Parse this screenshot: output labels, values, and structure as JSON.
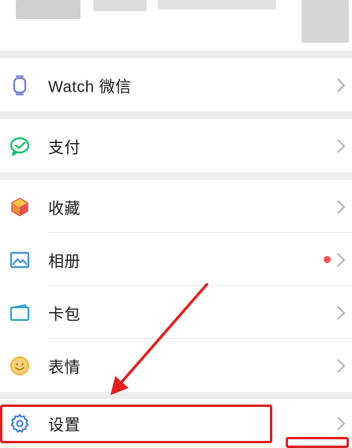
{
  "menu": {
    "watch": {
      "label": "Watch 微信",
      "icon": "watch-icon"
    },
    "pay": {
      "label": "支付",
      "icon": "wallet-icon"
    },
    "favorites": {
      "label": "收藏",
      "icon": "cube-icon"
    },
    "album": {
      "label": "相册",
      "icon": "image-icon",
      "has_badge": true
    },
    "card": {
      "label": "卡包",
      "icon": "card-icon"
    },
    "emoji": {
      "label": "表情",
      "icon": "smile-icon"
    },
    "settings": {
      "label": "设置",
      "icon": "gear-icon"
    }
  },
  "colors": {
    "background": "#ededed",
    "row": "#ffffff",
    "badge": "#fa5151",
    "annotation": "#e02020",
    "pay_icon": "#07c160",
    "album_icon": "#3b8fd9",
    "emoji_icon": "#f3b23a",
    "settings_icon": "#3a7fd5",
    "watch_icon": "#6f7fd6"
  }
}
